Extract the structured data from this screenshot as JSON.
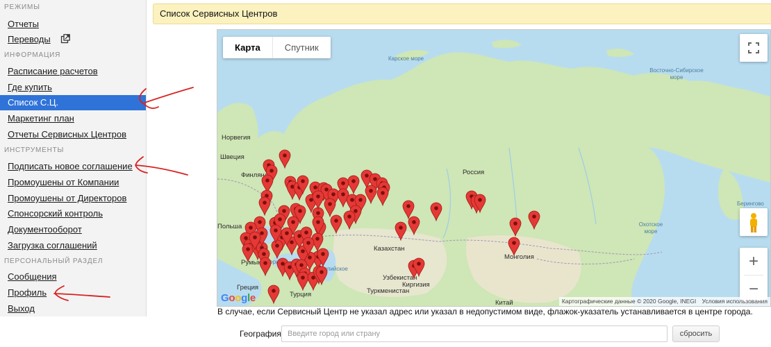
{
  "sidebar": {
    "sections": [
      {
        "title": "РЕЖИМЫ",
        "items": [
          {
            "label": "Отчеты"
          },
          {
            "label": "Переводы"
          }
        ]
      },
      {
        "title": "ИНФОРМАЦИЯ",
        "items": [
          {
            "label": "Расписание расчетов"
          },
          {
            "label": "Где купить"
          },
          {
            "label": "Список С.Ц."
          },
          {
            "label": "Маркетинг план"
          },
          {
            "label": "Отчеты Сервисных Центров"
          }
        ]
      },
      {
        "title": "ИНСТРУМЕНТЫ",
        "items": [
          {
            "label": "Подписать новое соглашение"
          },
          {
            "label": "Промоушены от Компании"
          },
          {
            "label": "Промоушены от Директоров"
          },
          {
            "label": "Спонсорский контроль"
          },
          {
            "label": "Документооборот"
          },
          {
            "label": "Загрузка соглашений"
          }
        ]
      },
      {
        "title": "ПЕРСОНАЛЬНЫЙ РАЗДЕЛ",
        "items": [
          {
            "label": "Сообщения"
          },
          {
            "label": "Профиль"
          },
          {
            "label": "Выход"
          }
        ]
      }
    ],
    "active_item": "Список С.Ц.",
    "icons": {
      "external": "external-link-icon"
    }
  },
  "header": {
    "title": "Список Сервисных Центров"
  },
  "map": {
    "type_buttons": [
      {
        "label": "Карта"
      },
      {
        "label": "Спутник"
      }
    ],
    "selected_type": "Карта",
    "labels": {
      "kara_sea": "Карское море",
      "east_siberian_sea": "Восточно-Сибирское море",
      "russia": "Россия",
      "sweden": "Швеция",
      "finland": "Финляндия",
      "poland": "Польша",
      "romania": "Румыния",
      "greece": "Греция",
      "turkey": "Турция",
      "kazakhstan": "Казахстан",
      "uzbekistan": "Узбекистан",
      "turkmenistan": "Туркменистан",
      "kyrgyzstan": "Киргизия",
      "mongolia": "Монголия",
      "china": "Китай",
      "okhotsk_sea": "Охотское море",
      "bering": "Берингово",
      "black_sea": "Черное",
      "caspian": "Каспийское",
      "norway": "Норвегия"
    },
    "logo": "Google",
    "attribution": "Картографические данные © 2020 Google, INEGI",
    "terms": "Условия использования",
    "zoom_in": "+",
    "zoom_out": "−",
    "pin_color": "#e53935",
    "icons": [
      "fullscreen-icon",
      "pegman-icon",
      "map-pin-icon"
    ]
  },
  "note": "В случае, если Сервисный Центр не указал адрес или указал в недопустимом виде, флажок-указатель устанавливается в центре города.",
  "search": {
    "label": "География",
    "placeholder": "Введите город или страну",
    "value": "",
    "reset_label": "сбросить"
  },
  "colors": {
    "active": "#2f73d8",
    "header_bg": "#fcf2bf",
    "annotation": "#d92121",
    "land": "#cfe6b6",
    "water": "#b8dcef"
  }
}
